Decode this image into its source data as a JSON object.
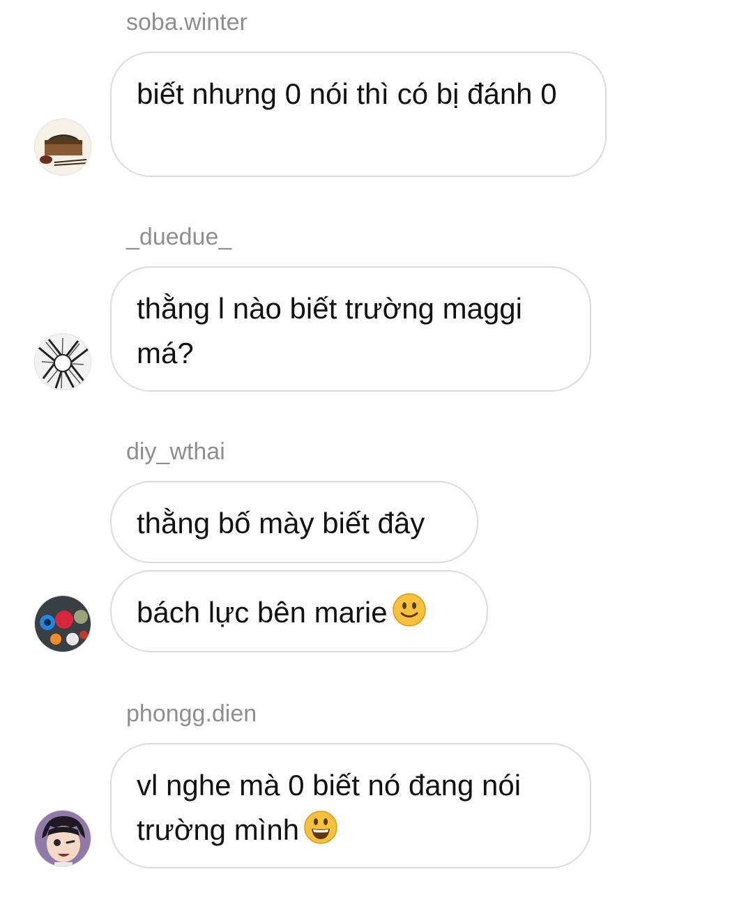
{
  "messages": [
    {
      "username": "soba.winter",
      "texts": [
        "biết nhưng 0 nói thì có bị đánh 0"
      ],
      "avatar_icon": "soba-noodles-avatar"
    },
    {
      "username": "_duedue_",
      "texts": [
        "thằng l nào biết trường maggi má?"
      ],
      "avatar_icon": "manga-sketch-avatar"
    },
    {
      "username": "diy_wthai",
      "texts": [
        "thằng bố mày biết đây",
        "bách lực bên marie"
      ],
      "avatar_icon": "fruit-stickers-avatar"
    },
    {
      "username": "phongg.dien",
      "texts": [
        "vl nghe mà 0 biết nó đang nói trường mình"
      ],
      "avatar_icon": "anime-face-avatar"
    }
  ],
  "emoji": {
    "slight_smile": "slightly-smiling-face-icon",
    "grin": "grinning-face-icon",
    "color": "#f7c13b"
  }
}
